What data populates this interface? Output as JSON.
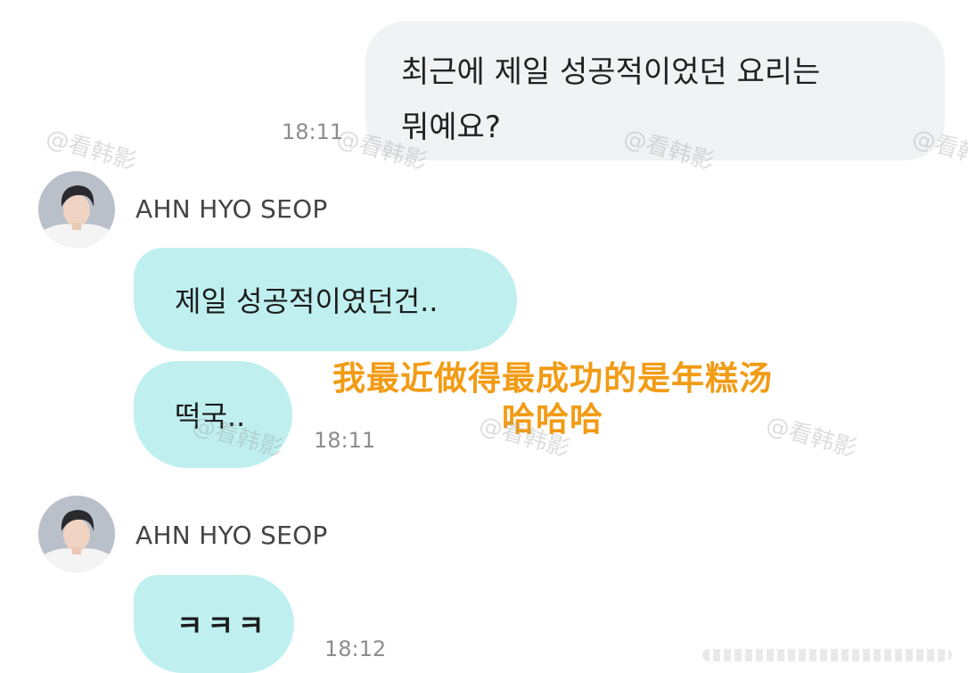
{
  "messages": {
    "outgoing": {
      "line1": "최근에 제일 성공적이었던 요리는",
      "line2": "뭐예요?",
      "time": "18:11"
    },
    "group1": {
      "sender": "AHN HYO SEOP",
      "bubble1": "제일 성공적이였던건..",
      "bubble2": "떡국..",
      "time": "18:11"
    },
    "group2": {
      "sender": "AHN HYO SEOP",
      "bubble1": "ㅋㅋㅋ",
      "time": "18:12"
    }
  },
  "caption": {
    "line1": "我最近做得最成功的是年糕汤",
    "line2": "哈哈哈"
  },
  "watermark": {
    "text": "@看韩影"
  },
  "colors": {
    "outgoing_bubble": "#f1f2f4",
    "incoming_bubble": "#bff0ef",
    "caption": "#f29b14",
    "time": "#8d8d8d"
  },
  "icons": {
    "avatar": "profile-photo"
  }
}
